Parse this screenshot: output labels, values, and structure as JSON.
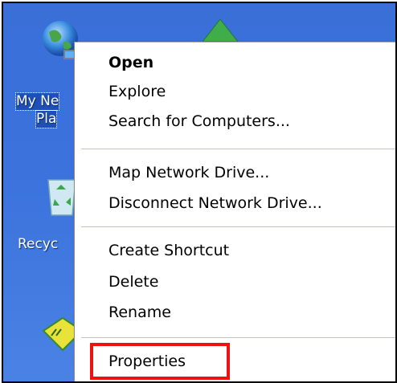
{
  "desktop": {
    "icons": [
      {
        "name": "my-network-places",
        "label_line1": "My Ne",
        "label_line2": "Pla"
      },
      {
        "name": "recycle-bin",
        "label_line1": "Recyc"
      }
    ]
  },
  "context_menu": {
    "items": [
      {
        "label": "Open",
        "bold": true
      },
      {
        "label": "Explore"
      },
      {
        "label": "Search for Computers..."
      },
      {
        "label": "Map Network Drive..."
      },
      {
        "label": "Disconnect Network Drive..."
      },
      {
        "label": "Create Shortcut"
      },
      {
        "label": "Delete"
      },
      {
        "label": "Rename"
      },
      {
        "label": "Properties",
        "highlighted": true
      }
    ]
  },
  "colors": {
    "desktop_blue": "#3b72dc",
    "highlight_red": "#ee1111",
    "menu_background": "#ffffff"
  }
}
